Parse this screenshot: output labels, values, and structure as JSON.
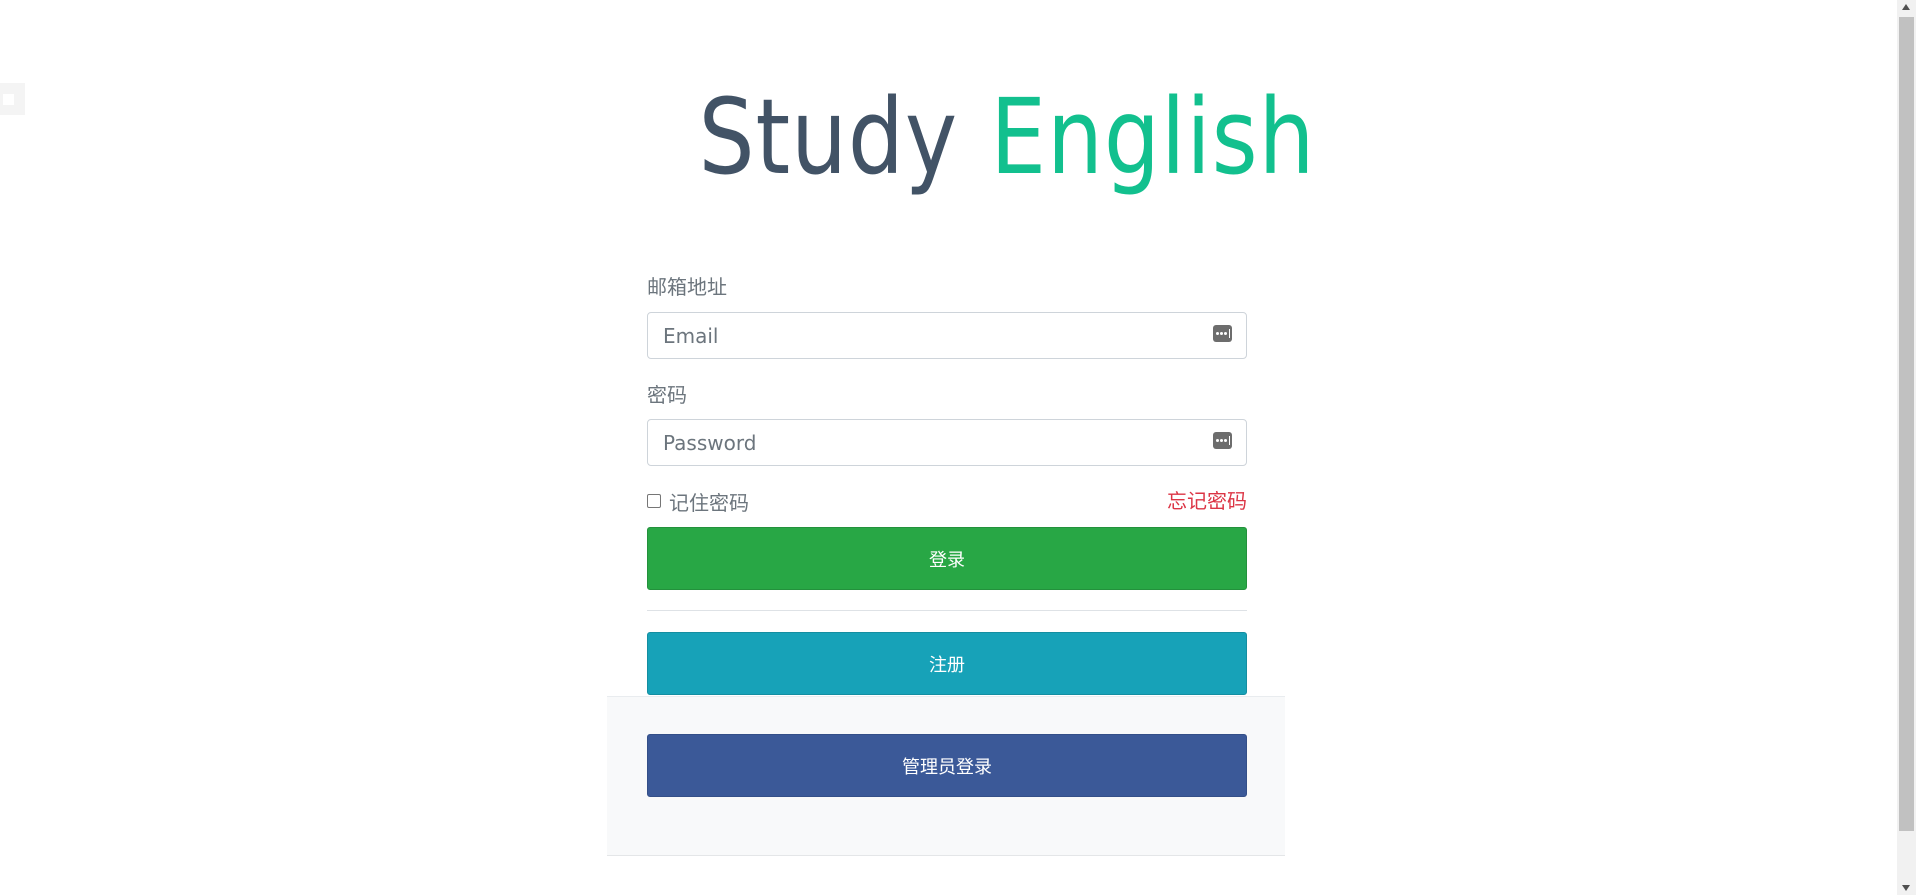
{
  "logo": {
    "word1": "Study",
    "word2": "English",
    "colors": {
      "word1": "#425366",
      "word2": "#12c08e"
    }
  },
  "form": {
    "email_label": "邮箱地址",
    "email_placeholder": "Email",
    "email_value": "",
    "password_label": "密码",
    "password_placeholder": "Password",
    "password_value": "",
    "remember_label": "记住密码",
    "remember_checked": false,
    "forgot_link": "忘记密码",
    "field_icon": "password-manager-key-icon"
  },
  "buttons": {
    "login": "登录",
    "register": "注册",
    "admin_login": "管理员登录"
  },
  "colors": {
    "login": "#28a745",
    "register": "#17a2b8",
    "admin_login": "#3b5998",
    "forgot_link": "#dc3545"
  }
}
